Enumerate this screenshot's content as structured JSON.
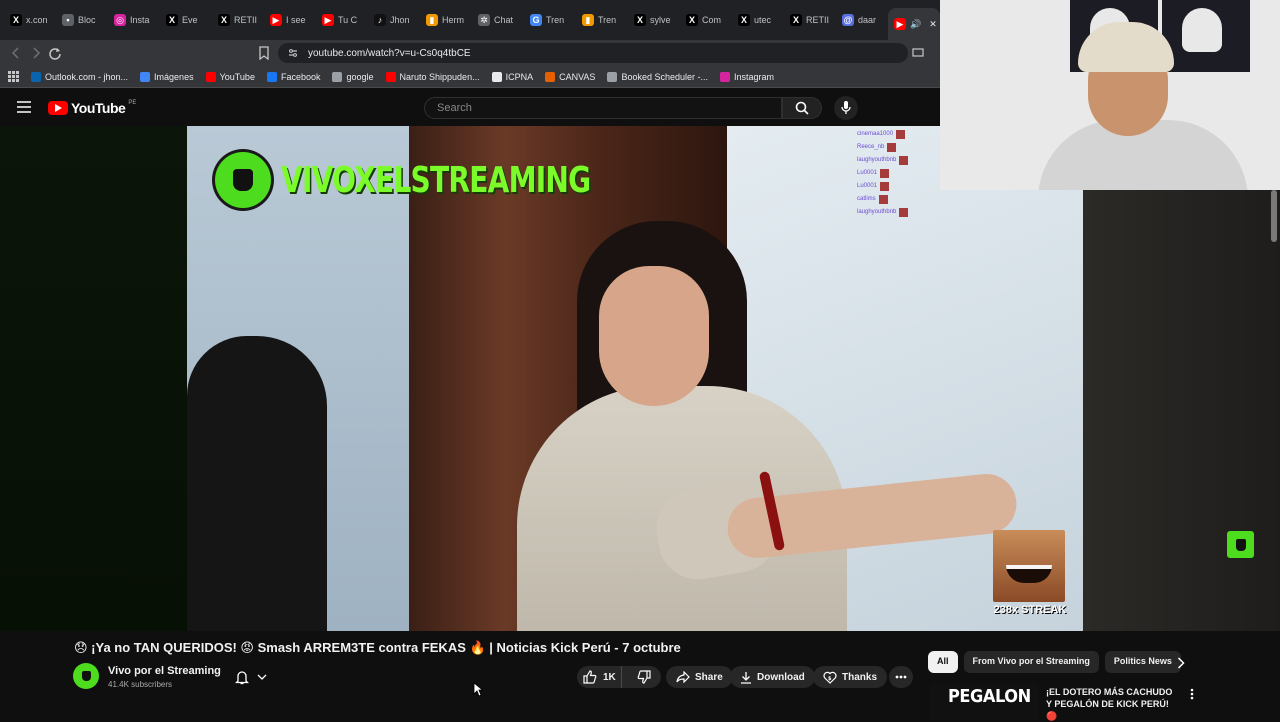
{
  "browser": {
    "tabs": [
      {
        "label": "x.con",
        "icon": "x-icon",
        "color": "#000000"
      },
      {
        "label": "Bloc",
        "icon": "bookmark-icon",
        "color": "#5f6368"
      },
      {
        "label": "Insta",
        "icon": "instagram-icon",
        "color": "#d6249f"
      },
      {
        "label": "Eve",
        "icon": "x-icon",
        "color": "#000000"
      },
      {
        "label": "RETII",
        "icon": "x-icon",
        "color": "#000000"
      },
      {
        "label": "I see",
        "icon": "youtube-icon",
        "color": "#ff0000"
      },
      {
        "label": "Tu C",
        "icon": "youtube-icon",
        "color": "#ff0000"
      },
      {
        "label": "Jhon",
        "icon": "tiktok-icon",
        "color": "#111111"
      },
      {
        "label": "Herm",
        "icon": "slides-icon",
        "color": "#f29900"
      },
      {
        "label": "Chat",
        "icon": "chatgpt-icon",
        "color": "#5f6368"
      },
      {
        "label": "Tren",
        "icon": "google-icon",
        "color": "#4285f4"
      },
      {
        "label": "Tren",
        "icon": "slides-icon",
        "color": "#f29900"
      },
      {
        "label": "sylve",
        "icon": "x-icon",
        "color": "#000000"
      },
      {
        "label": "Com",
        "icon": "x-icon",
        "color": "#000000"
      },
      {
        "label": "utec",
        "icon": "x-icon",
        "color": "#000000"
      },
      {
        "label": "RETII",
        "icon": "x-icon",
        "color": "#000000"
      },
      {
        "label": "daar",
        "icon": "spiral-icon",
        "color": "#5b6ee1"
      }
    ],
    "url": "youtube.com/watch?v=u-Cs0q4tbCE",
    "bookmarks": [
      {
        "label": "Outlook.com - jhon...",
        "color": "#0a64ad"
      },
      {
        "label": "Imágenes",
        "color": "#4285f4"
      },
      {
        "label": "YouTube",
        "color": "#ff0000"
      },
      {
        "label": "Facebook",
        "color": "#1877f2"
      },
      {
        "label": "google",
        "color": "#9aa0a6"
      },
      {
        "label": "Naruto Shippuden...",
        "color": "#ff0000"
      },
      {
        "label": "ICPNA",
        "color": "#e8eaed"
      },
      {
        "label": "CANVAS",
        "color": "#e66000"
      },
      {
        "label": "Booked Scheduler -...",
        "color": "#9aa0a6"
      },
      {
        "label": "Instagram",
        "color": "#d6249f"
      }
    ]
  },
  "youtube": {
    "logo_text": "YouTube",
    "country_code": "PE",
    "search_placeholder": "Search"
  },
  "video": {
    "overlay_title": "VIVOXELSTREAMING",
    "chat_lines": [
      "cinemaa1000",
      "Reece_nb",
      "laughyouthbnb",
      "Lu0001",
      "Lu0001",
      "catlims",
      "laughyouthbnb"
    ],
    "streak_text": "238x STREAK",
    "title": "😞 ¡Ya no TAN QUERIDOS! 😡 Smash ARREM3TE contra FEKAS 🔥 | Noticias Kick Perú - 7 octubre",
    "channel_name": "Vivo por el Streaming",
    "subscribers": "41.4K subscribers",
    "likes": "1K",
    "share_label": "Share",
    "download_label": "Download",
    "thanks_label": "Thanks"
  },
  "sidebar": {
    "chips": [
      "All",
      "From Vivo por el Streaming",
      "Politics News"
    ],
    "recommendation": {
      "thumb_text": "PEGALON",
      "title": "¡EL DOTERO MÁS CACHUDO Y PEGALÓN DE KICK PERÚ! 🔴"
    }
  },
  "colors": {
    "accent_green": "#4ddc1e",
    "youtube_red": "#ff0000",
    "background": "#0f0f0f"
  }
}
